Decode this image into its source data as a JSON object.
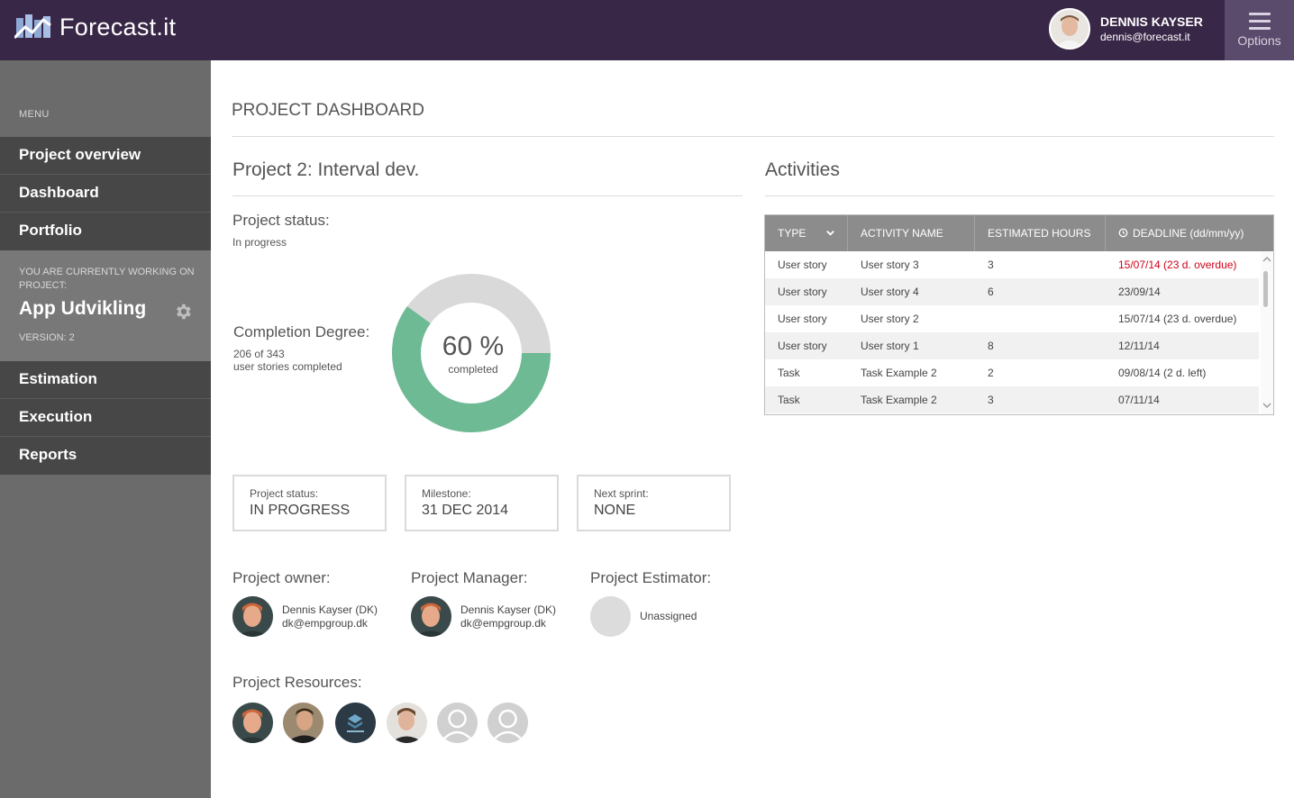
{
  "header": {
    "app_name": "Forecast.it",
    "user_name": "DENNIS KAYSER",
    "user_email": "dennis@forecast.it",
    "options_label": "Options"
  },
  "sidebar": {
    "menu_label": "MENU",
    "top_items": [
      "Project overview",
      "Dashboard",
      "Portfolio"
    ],
    "current_project_label": "YOU ARE CURRENTLY WORKING ON PROJECT:",
    "current_project_name": "App Udvikling",
    "version_label": "VERSION: 2",
    "bottom_items": [
      "Estimation",
      "Execution",
      "Reports"
    ]
  },
  "main": {
    "page_title": "PROJECT DASHBOARD",
    "project_title": "Project 2: Interval dev.",
    "status_heading": "Project status:",
    "status_value": "In progress",
    "completion_heading": "Completion Degree:",
    "completion_count": "206 of 343",
    "completion_suffix": "user stories completed",
    "completion_percent_label": "60 %",
    "completion_percent": 60,
    "completion_caption": "completed",
    "cards": [
      {
        "label": "Project status:",
        "value": "IN PROGRESS"
      },
      {
        "label": "Milestone:",
        "value": "31 DEC 2014"
      },
      {
        "label": "Next sprint:",
        "value": "NONE"
      }
    ],
    "owner_heading": "Project owner:",
    "owner_name": "Dennis Kayser (DK)",
    "owner_email": "dk@empgroup.dk",
    "manager_heading": "Project Manager:",
    "manager_name": "Dennis Kayser (DK)",
    "manager_email": "dk@empgroup.dk",
    "estimator_heading": "Project Estimator:",
    "estimator_value": "Unassigned",
    "resources_heading": "Project Resources:"
  },
  "activities": {
    "title": "Activities",
    "columns": [
      "TYPE",
      "ACTIVITY NAME",
      "ESTIMATED HOURS",
      "DEADLINE (dd/mm/yy)"
    ],
    "rows": [
      {
        "type": "User story",
        "name": "User story 3",
        "hours": "3",
        "deadline": "15/07/14  (23 d. overdue)",
        "overdue": true
      },
      {
        "type": "User story",
        "name": "User story 4",
        "hours": "6",
        "deadline": "23/09/14",
        "overdue": false
      },
      {
        "type": "User story",
        "name": "User story 2",
        "hours": "",
        "deadline": "15/07/14  (23 d. overdue)",
        "overdue": false
      },
      {
        "type": "User story",
        "name": "User story 1",
        "hours": "8",
        "deadline": "12/11/14",
        "overdue": false
      },
      {
        "type": "Task",
        "name": "Task Example 2",
        "hours": "2",
        "deadline": "09/08/14  (2 d. left)",
        "overdue": false
      },
      {
        "type": "Task",
        "name": "Task Example 2",
        "hours": "3",
        "deadline": "07/11/14",
        "overdue": false
      }
    ]
  },
  "colors": {
    "topbar": "#392747",
    "sidebar": "#6b6b6b",
    "donut_fill": "#6dba94",
    "donut_track": "#d9d9d9",
    "overdue": "#d0021b"
  }
}
